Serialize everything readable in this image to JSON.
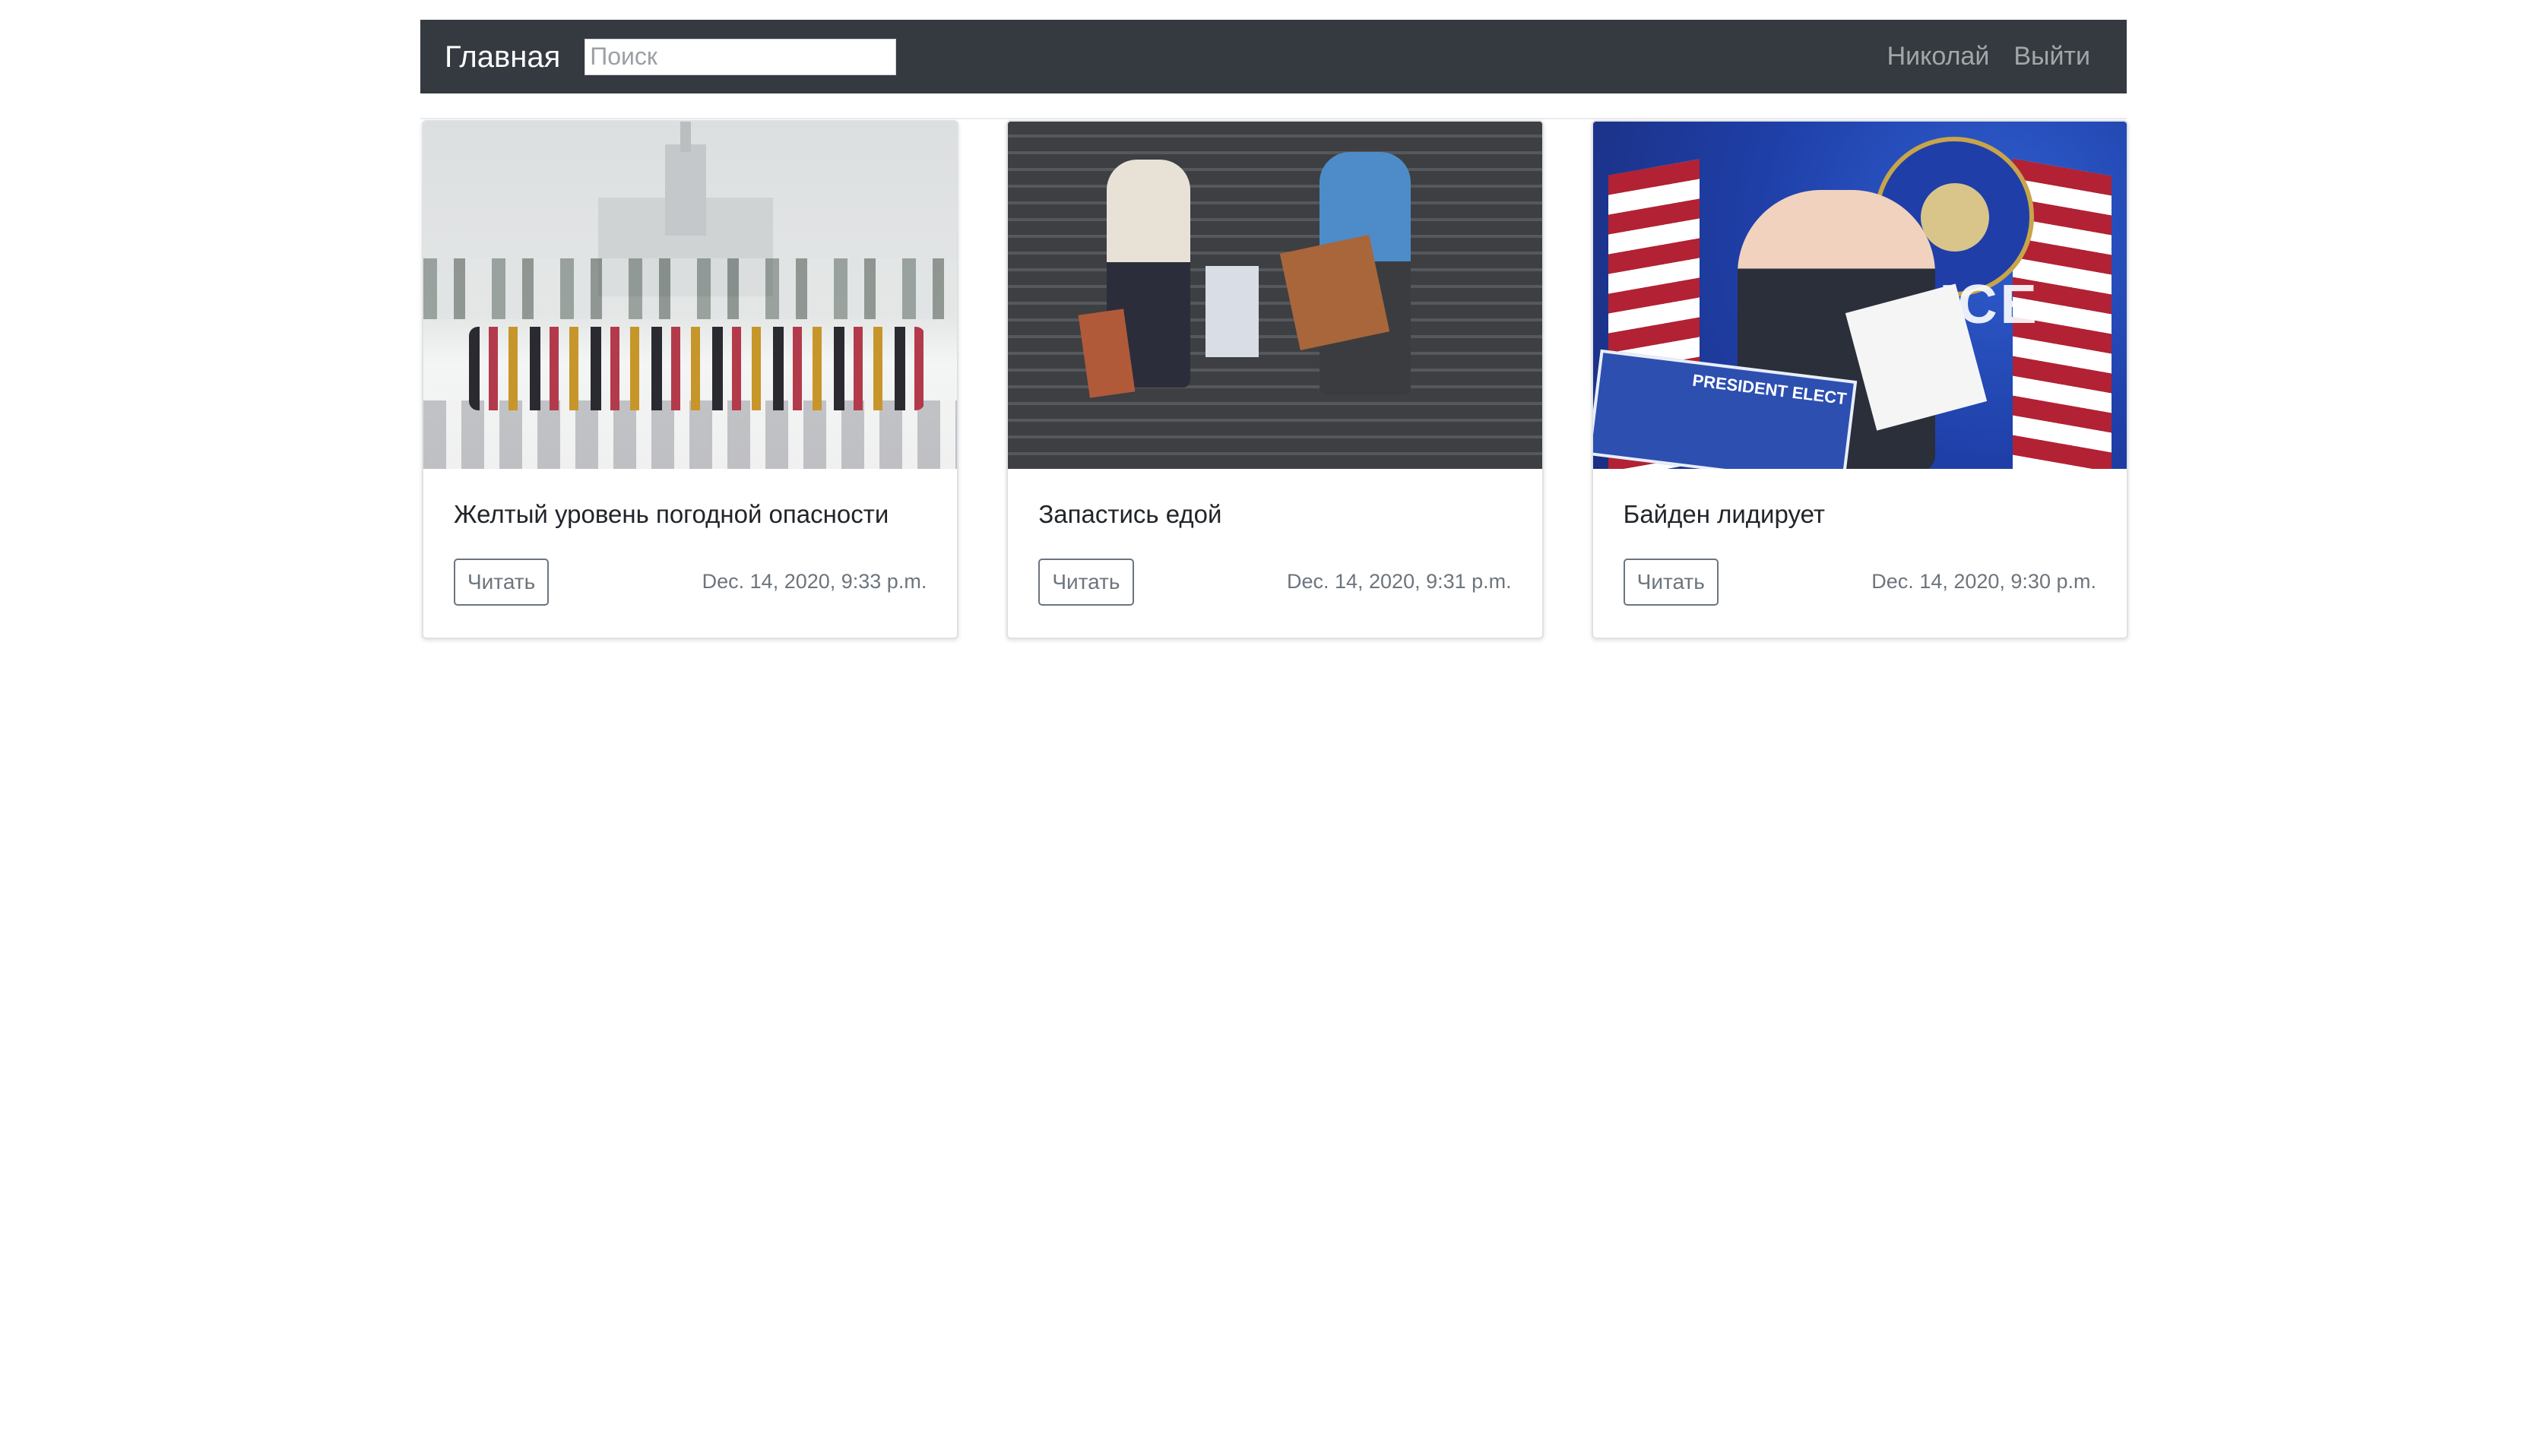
{
  "navbar": {
    "brand": "Главная",
    "search_placeholder": "Поиск",
    "user_link": "Николай",
    "logout_link": "Выйти"
  },
  "articles": [
    {
      "title": "Желтый уровень погодной опасности",
      "button_label": "Читать",
      "date": "Dec. 14, 2020, 9:33 p.m."
    },
    {
      "title": "Запастись едой",
      "button_label": "Читать",
      "date": "Dec. 14, 2020, 9:31 p.m."
    },
    {
      "title": "Байден лидирует",
      "button_label": "Читать",
      "date": "Dec. 14, 2020, 9:30 p.m."
    }
  ],
  "image_text": {
    "press_wall": "OFFICE",
    "podium": "PRESIDENT ELECT"
  },
  "colors": {
    "navbar_bg": "#343a40",
    "button_border": "#6c757d"
  }
}
